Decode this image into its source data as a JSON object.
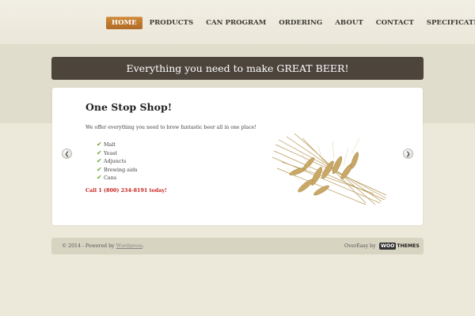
{
  "nav": {
    "items": [
      {
        "label": "HOME",
        "active": true
      },
      {
        "label": "PRODUCTS",
        "active": false
      },
      {
        "label": "CAN PROGRAM",
        "active": false
      },
      {
        "label": "ORDERING",
        "active": false
      },
      {
        "label": "ABOUT",
        "active": false
      },
      {
        "label": "CONTACT",
        "active": false
      },
      {
        "label": "SPECIFICATIONS",
        "active": false
      }
    ]
  },
  "banner": {
    "text": "Everything you need to make GREAT BEER!"
  },
  "slide": {
    "title": "One Stop Shop!",
    "intro": "We offer everything you need to brew fantastic beer all in one place!",
    "features": [
      "Malt",
      "Yeast",
      "Adjuncts",
      "Brewing aids",
      "Cans"
    ],
    "call": "Call 1 (800) 234-8191 today!",
    "image": "wheat-stalks-image"
  },
  "slider": {
    "prev_icon": "chevron-left-icon",
    "next_icon": "chevron-right-icon"
  },
  "footer": {
    "copyright_prefix": "© 2014 - Powered by",
    "wordpress_link": "Wordpress",
    "copyright_suffix": ".",
    "theme_text": "OverEasy by",
    "brand_woo": "WOO",
    "brand_themes": "THEMES"
  },
  "colors": {
    "background": "#ece8da",
    "accent": "#c07a30",
    "banner": "#4d443c",
    "call_text": "#c8201d",
    "check": "#6ea535"
  }
}
